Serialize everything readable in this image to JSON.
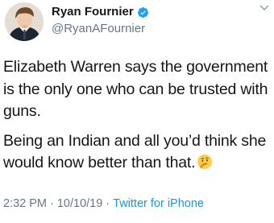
{
  "author": {
    "display_name": "Ryan Fournier",
    "handle": "@RyanAFournier",
    "verified": true
  },
  "tweet": {
    "paragraph_1": "Elizabeth Warren says the government is the only one who can be trusted with guns.",
    "paragraph_2": "Being an Indian and all you’d think she would know better than that.",
    "emoji": "thinking-face"
  },
  "meta": {
    "time": "2:32 PM",
    "separator": "·",
    "date": "10/10/19",
    "source": "Twitter for iPhone"
  },
  "icons": {
    "verified": "verified-badge-icon",
    "menu": "chevron-down-icon"
  },
  "colors": {
    "text": "#14171a",
    "secondary": "#657786",
    "link": "#1b95e0",
    "verified": "#1da1f2"
  }
}
